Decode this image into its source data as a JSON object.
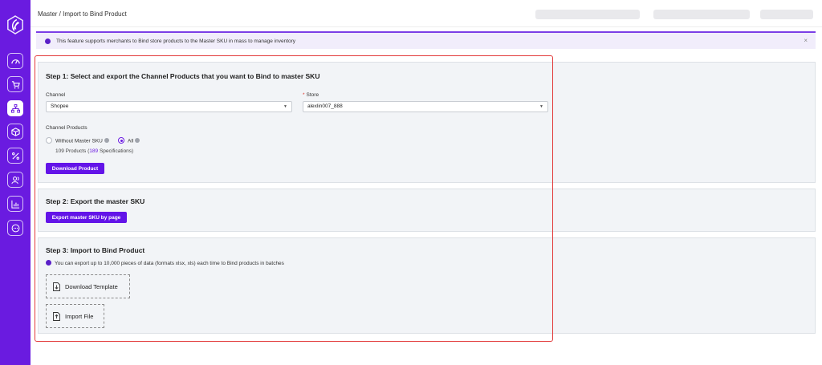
{
  "app": {
    "breadcrumb": "Master / Import to Bind Product",
    "brand_color": "#6a1be0",
    "sidebar": [
      {
        "name": "dashboard-icon",
        "active": false
      },
      {
        "name": "cart-icon",
        "active": false
      },
      {
        "name": "master-sku-icon",
        "active": true
      },
      {
        "name": "box-icon",
        "active": false
      },
      {
        "name": "percent-icon",
        "active": false
      },
      {
        "name": "users-icon",
        "active": false
      },
      {
        "name": "chart-icon",
        "active": false
      },
      {
        "name": "chat-icon",
        "active": false
      }
    ]
  },
  "notice": {
    "text": "This feature supports merchants to Bind store products to the Master SKU in mass to manage inventory",
    "close": "×"
  },
  "step1": {
    "title": "Step 1: Select and export the Channel Products that you want to Bind to master SKU",
    "channel_label": "Channel",
    "channel_value": "Shopee",
    "store_required": "*",
    "store_label": "Store",
    "store_value": "alexlin007_888",
    "channel_products_label": "Channel Products",
    "radio_without": "Without Master SKU",
    "radio_all": "All",
    "count_prefix": "109 Products (",
    "count_specs": "189",
    "count_suffix": " Specifications)",
    "download_button": "Download Product"
  },
  "step2": {
    "title": "Step 2: Export the master SKU",
    "export_button": "Export master SKU by page"
  },
  "step3": {
    "title": "Step 3: Import to Bind Product",
    "info": "You can export up to 10,000 pieces of data (formats xlsx, xls) each time to Bind products in batches",
    "download_template": "Download Template",
    "import_file": "Import File"
  }
}
